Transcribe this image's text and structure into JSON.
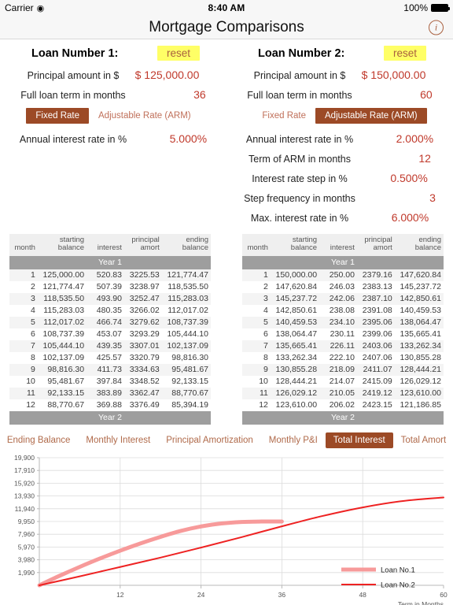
{
  "status_bar": {
    "carrier": "Carrier",
    "wifi_icon": "wifi-icon",
    "time": "8:40 AM",
    "battery_percent": "100%"
  },
  "navbar": {
    "title": "Mortgage Comparisons",
    "info_icon": "info-icon",
    "info_label": "i"
  },
  "loan1": {
    "title": "Loan Number 1:",
    "reset_label": "reset",
    "principal_label": "Principal amount in $",
    "principal_value": "$ 125,000.00",
    "term_label": "Full loan term in months",
    "term_value": "36",
    "seg_fixed": "Fixed Rate",
    "seg_arm": "Adjustable Rate (ARM)",
    "seg_selected": "Fixed Rate",
    "rate_label": "Annual interest rate in %",
    "rate_value": "5.000%"
  },
  "loan2": {
    "title": "Loan Number 2:",
    "reset_label": "reset",
    "principal_label": "Principal amount in $",
    "principal_value": "$ 150,000.00",
    "term_label": "Full loan term in months",
    "term_value": "60",
    "seg_fixed": "Fixed Rate",
    "seg_arm": "Adjustable Rate (ARM)",
    "seg_selected": "Adjustable Rate (ARM)",
    "rate_label": "Annual interest rate in %",
    "rate_value": "2.000%",
    "arm_term_label": "Term of ARM in months",
    "arm_term_value": "12",
    "step_label": "Interest rate step in %",
    "step_value": "0.500%",
    "step_freq_label": "Step frequency in months",
    "step_freq_value": "3",
    "max_rate_label": "Max. interest rate in %",
    "max_rate_value": "6.000%"
  },
  "table_headers": {
    "month": "month",
    "starting_balance": "starting\nbalance",
    "starting_balance_l1": "starting",
    "starting_balance_l2": "balance",
    "interest": "interest",
    "principal_amort_l1": "principal",
    "principal_amort_l2": "amort",
    "ending_balance_l1": "ending",
    "ending_balance_l2": "balance"
  },
  "table1": {
    "year1_label": "Year 1",
    "year2_label": "Year 2",
    "rows": [
      {
        "month": "1",
        "start": "125,000.00",
        "interest": "520.83",
        "amort": "3225.53",
        "end": "121,774.47"
      },
      {
        "month": "2",
        "start": "121,774.47",
        "interest": "507.39",
        "amort": "3238.97",
        "end": "118,535.50"
      },
      {
        "month": "3",
        "start": "118,535.50",
        "interest": "493.90",
        "amort": "3252.47",
        "end": "115,283.03"
      },
      {
        "month": "4",
        "start": "115,283.03",
        "interest": "480.35",
        "amort": "3266.02",
        "end": "112,017.02"
      },
      {
        "month": "5",
        "start": "112,017.02",
        "interest": "466.74",
        "amort": "3279.62",
        "end": "108,737.39"
      },
      {
        "month": "6",
        "start": "108,737.39",
        "interest": "453.07",
        "amort": "3293.29",
        "end": "105,444.10"
      },
      {
        "month": "7",
        "start": "105,444.10",
        "interest": "439.35",
        "amort": "3307.01",
        "end": "102,137.09"
      },
      {
        "month": "8",
        "start": "102,137.09",
        "interest": "425.57",
        "amort": "3320.79",
        "end": "98,816.30"
      },
      {
        "month": "9",
        "start": "98,816.30",
        "interest": "411.73",
        "amort": "3334.63",
        "end": "95,481.67"
      },
      {
        "month": "10",
        "start": "95,481.67",
        "interest": "397.84",
        "amort": "3348.52",
        "end": "92,133.15"
      },
      {
        "month": "11",
        "start": "92,133.15",
        "interest": "383.89",
        "amort": "3362.47",
        "end": "88,770.67"
      },
      {
        "month": "12",
        "start": "88,770.67",
        "interest": "369.88",
        "amort": "3376.49",
        "end": "85,394.19"
      }
    ]
  },
  "table2": {
    "year1_label": "Year 1",
    "year2_label": "Year 2",
    "rows": [
      {
        "month": "1",
        "start": "150,000.00",
        "interest": "250.00",
        "amort": "2379.16",
        "end": "147,620.84"
      },
      {
        "month": "2",
        "start": "147,620.84",
        "interest": "246.03",
        "amort": "2383.13",
        "end": "145,237.72"
      },
      {
        "month": "3",
        "start": "145,237.72",
        "interest": "242.06",
        "amort": "2387.10",
        "end": "142,850.61"
      },
      {
        "month": "4",
        "start": "142,850.61",
        "interest": "238.08",
        "amort": "2391.08",
        "end": "140,459.53"
      },
      {
        "month": "5",
        "start": "140,459.53",
        "interest": "234.10",
        "amort": "2395.06",
        "end": "138,064.47"
      },
      {
        "month": "6",
        "start": "138,064.47",
        "interest": "230.11",
        "amort": "2399.06",
        "end": "135,665.41"
      },
      {
        "month": "7",
        "start": "135,665.41",
        "interest": "226.11",
        "amort": "2403.06",
        "end": "133,262.34"
      },
      {
        "month": "8",
        "start": "133,262.34",
        "interest": "222.10",
        "amort": "2407.06",
        "end": "130,855.28"
      },
      {
        "month": "9",
        "start": "130,855.28",
        "interest": "218.09",
        "amort": "2411.07",
        "end": "128,444.21"
      },
      {
        "month": "10",
        "start": "128,444.21",
        "interest": "214.07",
        "amort": "2415.09",
        "end": "126,029.12"
      },
      {
        "month": "11",
        "start": "126,029.12",
        "interest": "210.05",
        "amort": "2419.12",
        "end": "123,610.00"
      },
      {
        "month": "12",
        "start": "123,610.00",
        "interest": "206.02",
        "amort": "2423.15",
        "end": "121,186.85"
      }
    ]
  },
  "tabs": [
    {
      "label": "Ending Balance",
      "active": false
    },
    {
      "label": "Monthly Interest",
      "active": false
    },
    {
      "label": "Principal Amortization",
      "active": false
    },
    {
      "label": "Monthly P&I",
      "active": false
    },
    {
      "label": "Total Interest",
      "active": true
    },
    {
      "label": "Total Amort",
      "active": false
    }
  ],
  "colors": {
    "accent_brown": "#9c4a26",
    "value_red": "#c0392b",
    "loan1_line": "#f79a9a",
    "loan2_line": "#ee2222",
    "reset_yellow": "#ffff66",
    "year_band_gray": "#9e9e9e"
  },
  "chart_data": {
    "type": "line",
    "title": "Total Interest",
    "xlabel": "Term in Months",
    "ylabel": "",
    "xlim": [
      0,
      60
    ],
    "ylim": [
      0,
      19900
    ],
    "grid": true,
    "legend_position": "bottom-right",
    "xticks": [
      12,
      24,
      36,
      48,
      60
    ],
    "yticks": [
      1990,
      3980,
      5970,
      7960,
      9950,
      11940,
      13930,
      15920,
      17910,
      19900
    ],
    "ytick_labels": [
      "1,990",
      "3,980",
      "5,970",
      "7,960",
      "9,950",
      "11,940",
      "13,930",
      "15,920",
      "17,910",
      "19,900"
    ],
    "series": [
      {
        "name": "Loan No.1",
        "color": "#f79a9a",
        "width": 5,
        "x": [
          0,
          3,
          6,
          9,
          12,
          15,
          18,
          21,
          24,
          27,
          30,
          33,
          36
        ],
        "y": [
          0,
          1480,
          2870,
          4180,
          5400,
          6530,
          7560,
          8480,
          9180,
          9640,
          9880,
          9945,
          9950
        ]
      },
      {
        "name": "Loan No.2",
        "color": "#ee2222",
        "width": 2,
        "x": [
          0,
          6,
          12,
          18,
          24,
          30,
          36,
          42,
          48,
          54,
          60
        ],
        "y": [
          0,
          1400,
          2860,
          4320,
          5880,
          7500,
          9200,
          10800,
          12150,
          13150,
          13700
        ]
      }
    ]
  }
}
